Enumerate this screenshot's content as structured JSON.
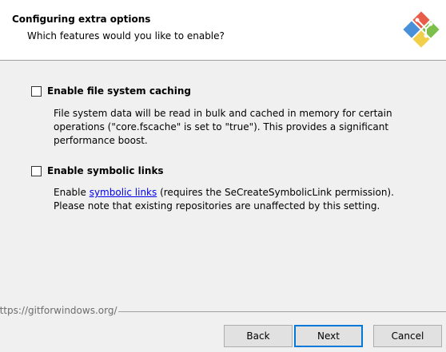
{
  "header": {
    "title": "Configuring extra options",
    "subtitle": "Which features would you like to enable?",
    "logo_icon": "git-logo-icon"
  },
  "options": [
    {
      "label": "Enable file system caching",
      "checked": false,
      "description_lines": [
        "File system data will be read in bulk and cached in memory for certain",
        "operations (\"core.fscache\" is set to \"true\"). This provides a significant",
        "performance boost."
      ]
    },
    {
      "label": "Enable symbolic links",
      "checked": false,
      "description": {
        "prefix": "Enable ",
        "link_text": "symbolic links",
        "suffix": " (requires the SeCreateSymbolicLink permission).",
        "line2": "Please note that existing repositories are unaffected by this setting."
      }
    }
  ],
  "footer": {
    "url": "https://gitforwindows.org/"
  },
  "buttons": {
    "back": "Back",
    "next": "Next",
    "cancel": "Cancel"
  },
  "colors": {
    "link": "#0000ee",
    "default_button_border": "#0078d7",
    "logo_red": "#e85c4a",
    "logo_green": "#7cc04b",
    "logo_blue": "#4a90d9",
    "logo_yellow": "#f2cf4a"
  }
}
